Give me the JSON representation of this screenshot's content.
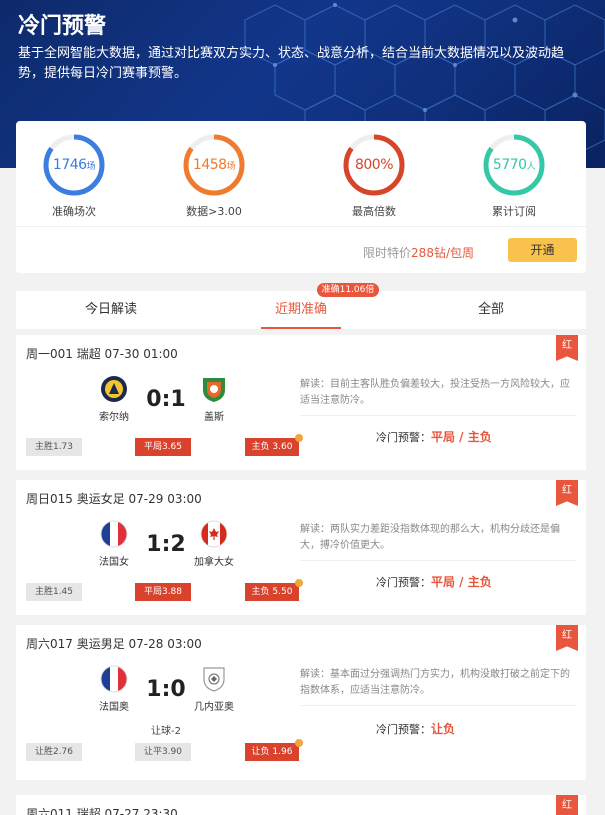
{
  "hero": {
    "title": "冷门预警",
    "description": "基于全网智能大数据，通过对比赛双方实力、状态、战意分析，结合当前大数据情况以及波动趋势，提供每日冷门赛事预警。"
  },
  "stats": [
    {
      "value": "1746",
      "unit": "场",
      "label": "准确场次",
      "color": "#3b7de0",
      "fraction": 0.85
    },
    {
      "value": "1458",
      "unit": "场",
      "label": "数据>3.00",
      "color": "#f07a2e",
      "fraction": 0.85
    },
    {
      "value": "800%",
      "unit": "",
      "label": "最高倍数",
      "color": "#d6452a",
      "fraction": 0.85
    },
    {
      "value": "5770",
      "unit": "人",
      "label": "累计订阅",
      "color": "#35c8a6",
      "fraction": 0.85
    }
  ],
  "promo": {
    "text": "限时特价",
    "price": "288钻/包周",
    "button": "开通"
  },
  "tabs": {
    "items": [
      "今日解读",
      "近期准确",
      "全部"
    ],
    "active": 1,
    "badge": "准确11.06倍"
  },
  "matches": [
    {
      "header": "周一001 瑞超 07-30 01:00",
      "tag": "红",
      "home": "索尔纳",
      "away": "盖斯",
      "score": "0:1",
      "handicap": "",
      "analysis": "解读：目前主客队胜负偏差较大，投注受热一方风险较大，应适当注意防冷。",
      "warning_label": "冷门预警：",
      "warning_value": "平局 / 主负",
      "odds": [
        {
          "text": "主胜1.73",
          "hit": false
        },
        {
          "text": "平局3.65",
          "hit": true
        },
        {
          "text": "主负 3.60",
          "hit": true
        }
      ]
    },
    {
      "header": "周日015 奥运女足 07-29 03:00",
      "tag": "红",
      "home": "法国女",
      "away": "加拿大女",
      "score": "1:2",
      "handicap": "",
      "analysis": "解读：两队实力差距没指数体现的那么大，机构分歧还是偏大，搏冷价值更大。",
      "warning_label": "冷门预警：",
      "warning_value": "平局 / 主负",
      "odds": [
        {
          "text": "主胜1.45",
          "hit": false
        },
        {
          "text": "平局3.88",
          "hit": true
        },
        {
          "text": "主负 5.50",
          "hit": true
        }
      ]
    },
    {
      "header": "周六017 奥运男足 07-28 03:00",
      "tag": "红",
      "home": "法国奥",
      "away": "几内亚奥",
      "score": "1:0",
      "handicap": "让球-2",
      "analysis": "解读：基本面过分强调热门方实力，机构没敢打破之前定下的指数体系，应适当注意防冷。",
      "warning_label": "冷门预警：",
      "warning_value": "让负",
      "odds": [
        {
          "text": "让胜2.76",
          "hit": false
        },
        {
          "text": "让平3.90",
          "hit": false
        },
        {
          "text": "让负 1.96",
          "hit": true
        }
      ]
    },
    {
      "header": "周六011 瑞超 07-27 23:30",
      "tag": "红"
    }
  ]
}
